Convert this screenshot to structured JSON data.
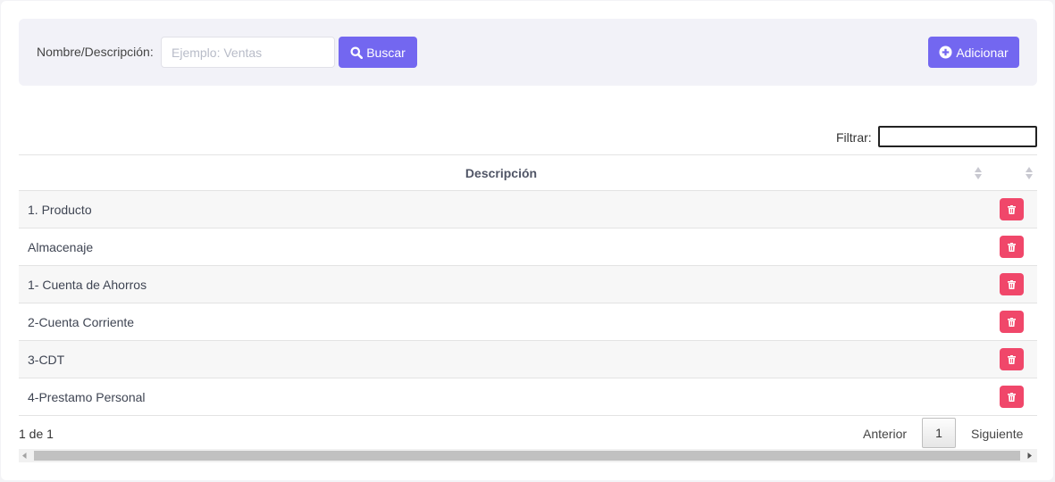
{
  "search": {
    "label": "Nombre/Descripción:",
    "placeholder": "Ejemplo: Ventas",
    "value": "",
    "search_button": "Buscar",
    "add_button": "Adicionar"
  },
  "filter": {
    "label": "Filtrar:",
    "value": ""
  },
  "table": {
    "columns": [
      "Descripción",
      ""
    ],
    "rows": [
      {
        "descripcion": "1. Producto"
      },
      {
        "descripcion": "Almacenaje"
      },
      {
        "descripcion": "1- Cuenta de Ahorros"
      },
      {
        "descripcion": "2-Cuenta Corriente"
      },
      {
        "descripcion": "3-CDT"
      },
      {
        "descripcion": "4-Prestamo Personal"
      }
    ],
    "row_action_icon": "trash-icon"
  },
  "pagination": {
    "info": "1 de 1",
    "prev": "Anterior",
    "current": "1",
    "next": "Siguiente"
  },
  "colors": {
    "primary": "#7367f0",
    "danger": "#f0476a",
    "panel": "#f2f2f8"
  }
}
